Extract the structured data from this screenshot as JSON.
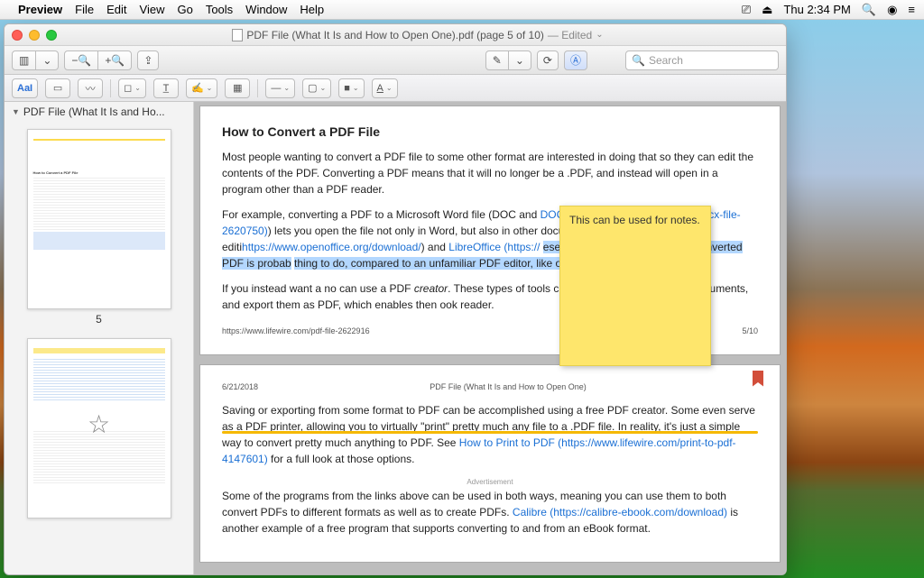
{
  "menubar": {
    "app": "Preview",
    "items": [
      "File",
      "Edit",
      "View",
      "Go",
      "Tools",
      "Window",
      "Help"
    ],
    "clock": "Thu 2:34 PM"
  },
  "window": {
    "title_main": "PDF File (What It Is and How to Open One).pdf (page 5 of 10)",
    "title_edited": "— Edited"
  },
  "search": {
    "placeholder": "Search"
  },
  "sidebar": {
    "title": "PDF File (What It Is and Ho...",
    "thumb5_label": "5"
  },
  "sticky": {
    "text": "This can be used for notes."
  },
  "page5": {
    "heading": "How to Convert a PDF File",
    "p1": "Most people wanting to convert a PDF file to some other format are interested in doing that so they can edit the contents of the PDF. Converting a PDF means that it will no longer be a .PDF, and instead will open in a program other than a PDF reader.",
    "p2a": "For example, converting a PDF to a Microsoft Word file (DOC and ",
    "p2b_link": "DOCX (https://www.lifewire.com/docx-file-2620750)",
    "p2c": ") lets you open the file not only in Word, but also in other document editi",
    "p2d_link": "https://www.openoffice.org/download/",
    "p2e": ") and ",
    "p2f_link": "LibreOffice (https://",
    "p2g_hl": "ese types of programs to edit a converted PDF is probab",
    "p2h_hl": "thing to do, compared to an unfamiliar PDF editor, like one of th",
    "p2i_hl": "e.",
    "p3a": "If you instead want a no",
    "p3b": "can use a PDF ",
    "p3c_i": "creator",
    "p3d": ". These types of tools can take things like",
    "p3e": "oft Word documents, and export them as PDF, which enables then",
    "p3f": "ook reader.",
    "footer_left": "https://www.lifewire.com/pdf-file-2622916",
    "footer_right": "5/10"
  },
  "page6": {
    "date": "6/21/2018",
    "header_title": "PDF File (What It Is and How to Open One)",
    "p1a": "Saving or exporting from some format to PDF can be accomplished using a free PDF creator. Some even serve as a PDF printer, allowing you to virtually \"print\" pretty much any file to a .PDF file. In reality, it's just a simple way to convert pretty much anything to PDF. See ",
    "p1b_link": "How to Print to PDF (https://www.lifewire.com/print-to-pdf-4147601)",
    "p1c": " for a full look at those options.",
    "advert": "Advertisement",
    "p2a": "Some of the programs from the links above can be used in both ways, meaning you can use them to both convert PDFs to different formats as well as to create PDFs. ",
    "p2b_link": "Calibre (https://calibre-ebook.com/download)",
    "p2c": " is another example of a free program that supports converting to and from an eBook format."
  }
}
